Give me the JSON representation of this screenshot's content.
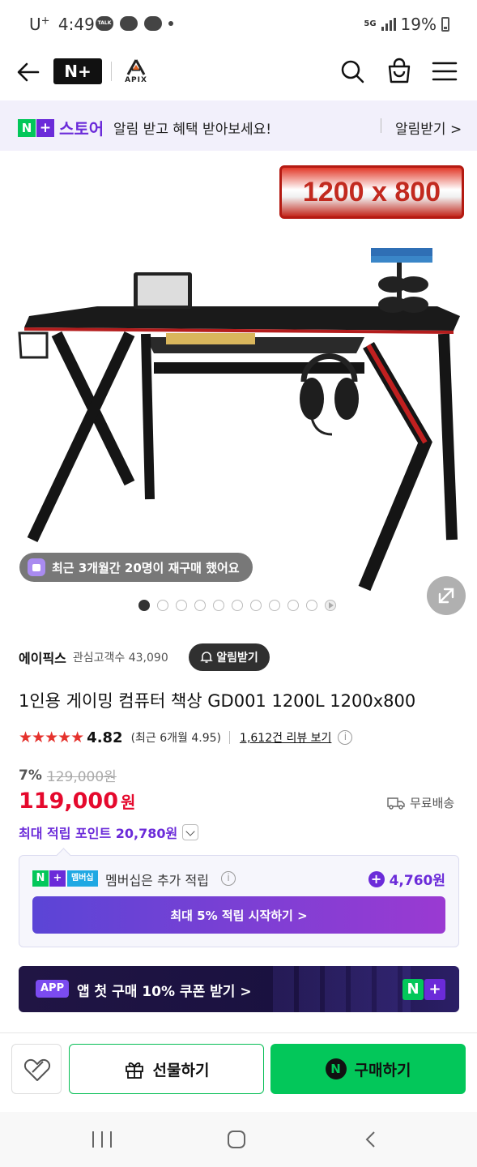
{
  "status_bar": {
    "carrier": "U",
    "carrier_sup": "+",
    "time": "4:49",
    "talk_icon_label": "TALK",
    "network": "5G",
    "battery": "19%"
  },
  "nav": {
    "brand_logo": "N+",
    "store_logo_text": "APIX"
  },
  "alert_banner": {
    "store_label": "스토어",
    "message": "알림 받고 혜택 받아보세요!",
    "cta": "알림받기 >"
  },
  "product_image": {
    "size_badge": "1200 x 800",
    "repurchase_text": "최근 3개월간 20명이 재구매 했어요",
    "slide_count": 11,
    "active_slide": 1
  },
  "store": {
    "name": "에이픽스",
    "followers": "관심고객수 43,090",
    "notify_button": "알림받기"
  },
  "product": {
    "title": "1인용 게이밍 컴퓨터 책상 GD001 1200L 1200x800",
    "stars": "★★★★★",
    "rating": "4.82",
    "recent_rating": "(최근 6개월 4.95)",
    "review_link": "1,612건 리뷰 보기",
    "discount": "7%",
    "original_price": "129,000원",
    "price": "119,000",
    "currency": "원",
    "shipping": "무료배송",
    "points": "최대 적립 포인트 20,780원"
  },
  "membership": {
    "tag": "멤버십",
    "text": "멤버십은 추가 적립",
    "points": "4,760원",
    "button": "최대 5% 적립 시작하기 >"
  },
  "app_banner": {
    "tag": "APP",
    "text": "앱 첫 구매 10% 쿠폰 받기 >"
  },
  "bottom_bar": {
    "gift_label": "선물하기",
    "buy_label": "구매하기",
    "buy_icon": "N"
  },
  "colors": {
    "naver_green": "#03c75a",
    "naver_purple": "#6b2bd9",
    "price_red": "#e5092d"
  }
}
